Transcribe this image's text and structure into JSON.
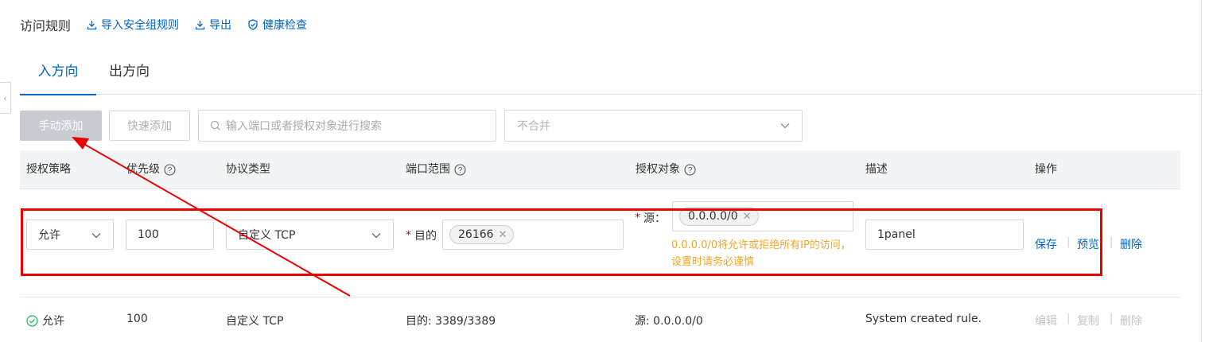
{
  "page_title": "访问规则",
  "toolbar": {
    "import_label": "导入安全组规则",
    "export_label": "导出",
    "health_label": "健康检查"
  },
  "tabs": [
    {
      "label": "入方向",
      "active": true
    },
    {
      "label": "出方向",
      "active": false
    }
  ],
  "actions": {
    "manual_add": "手动添加",
    "quick_add": "快速添加",
    "search_placeholder": "输入端口或者授权对象进行搜索",
    "merge_value": "不合并"
  },
  "table": {
    "headers": [
      "授权策略",
      "优先级",
      "协议类型",
      "端口范围",
      "授权对象",
      "描述",
      "操作"
    ]
  },
  "edit_row": {
    "policy": "允许",
    "priority": "100",
    "protocol": "自定义 TCP",
    "port_label": "目的",
    "port_tag": "26166",
    "source_label": "源：",
    "source_tag": "0.0.0.0/0",
    "warning": "0.0.0.0/0将允许或拒绝所有IP的访问，设置时请务必谨慎",
    "description": "1panel",
    "ops": [
      "保存",
      "预览",
      "删除"
    ]
  },
  "existing_row": {
    "policy": "允许",
    "priority": "100",
    "protocol": "自定义 TCP",
    "port": "目的: 3389/3389",
    "source": "源: 0.0.0.0/0",
    "description": "System created rule.",
    "ops": [
      "编辑",
      "复制",
      "删除"
    ]
  },
  "colors": {
    "link": "#0066cc",
    "warning": "#f5a623",
    "annotation": "#ea0000",
    "success": "#1fb35f"
  }
}
